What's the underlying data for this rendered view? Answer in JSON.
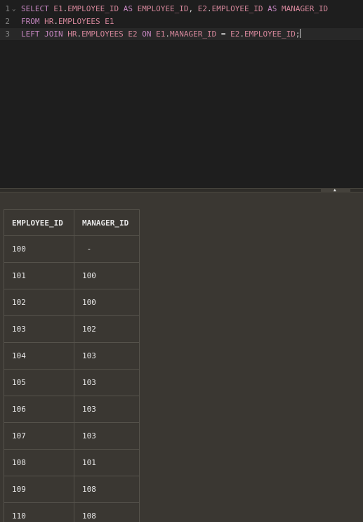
{
  "editor": {
    "lines": [
      {
        "num": "1",
        "tokens": [
          {
            "t": "SELECT",
            "c": "kw"
          },
          {
            "t": " ",
            "c": "op"
          },
          {
            "t": "E1",
            "c": "id"
          },
          {
            "t": ".",
            "c": "op"
          },
          {
            "t": "EMPLOYEE_ID",
            "c": "id"
          },
          {
            "t": " ",
            "c": "op"
          },
          {
            "t": "AS",
            "c": "kw"
          },
          {
            "t": " ",
            "c": "op"
          },
          {
            "t": "EMPLOYEE_ID",
            "c": "id"
          },
          {
            "t": ", ",
            "c": "op"
          },
          {
            "t": "E2",
            "c": "id"
          },
          {
            "t": ".",
            "c": "op"
          },
          {
            "t": "EMPLOYEE_ID",
            "c": "id"
          },
          {
            "t": " ",
            "c": "op"
          },
          {
            "t": "AS",
            "c": "kw"
          },
          {
            "t": " ",
            "c": "op"
          },
          {
            "t": "MANAGER_ID",
            "c": "id"
          }
        ]
      },
      {
        "num": "2",
        "tokens": [
          {
            "t": "FROM",
            "c": "kw"
          },
          {
            "t": " ",
            "c": "op"
          },
          {
            "t": "HR",
            "c": "id"
          },
          {
            "t": ".",
            "c": "op"
          },
          {
            "t": "EMPLOYEES",
            "c": "id"
          },
          {
            "t": " ",
            "c": "op"
          },
          {
            "t": "E1",
            "c": "id"
          }
        ]
      },
      {
        "num": "3",
        "tokens": [
          {
            "t": "LEFT",
            "c": "kw"
          },
          {
            "t": " ",
            "c": "op"
          },
          {
            "t": "JOIN",
            "c": "kw"
          },
          {
            "t": " ",
            "c": "op"
          },
          {
            "t": "HR",
            "c": "id"
          },
          {
            "t": ".",
            "c": "op"
          },
          {
            "t": "EMPLOYEES",
            "c": "id"
          },
          {
            "t": " ",
            "c": "op"
          },
          {
            "t": "E2",
            "c": "id"
          },
          {
            "t": " ",
            "c": "op"
          },
          {
            "t": "ON",
            "c": "kw"
          },
          {
            "t": " ",
            "c": "op"
          },
          {
            "t": "E1",
            "c": "id"
          },
          {
            "t": ".",
            "c": "op"
          },
          {
            "t": "MANAGER_ID",
            "c": "id"
          },
          {
            "t": " = ",
            "c": "op"
          },
          {
            "t": "E2",
            "c": "id"
          },
          {
            "t": ".",
            "c": "op"
          },
          {
            "t": "EMPLOYEE_ID",
            "c": "id"
          },
          {
            "t": ";",
            "c": "op"
          }
        ]
      }
    ],
    "fold_icon": "chevron-down-icon",
    "active_line": 3
  },
  "results": {
    "columns": [
      "EMPLOYEE_ID",
      "MANAGER_ID"
    ],
    "rows": [
      [
        "100",
        " -"
      ],
      [
        "101",
        "100"
      ],
      [
        "102",
        "100"
      ],
      [
        "103",
        "102"
      ],
      [
        "104",
        "103"
      ],
      [
        "105",
        "103"
      ],
      [
        "106",
        "103"
      ],
      [
        "107",
        "103"
      ],
      [
        "108",
        "101"
      ],
      [
        "109",
        "108"
      ],
      [
        "110",
        "108"
      ]
    ]
  },
  "colors": {
    "editor_bg": "#1e1e1e",
    "results_bg": "#3a3732",
    "keyword": "#c586c0",
    "identifier": "#d4869a"
  }
}
